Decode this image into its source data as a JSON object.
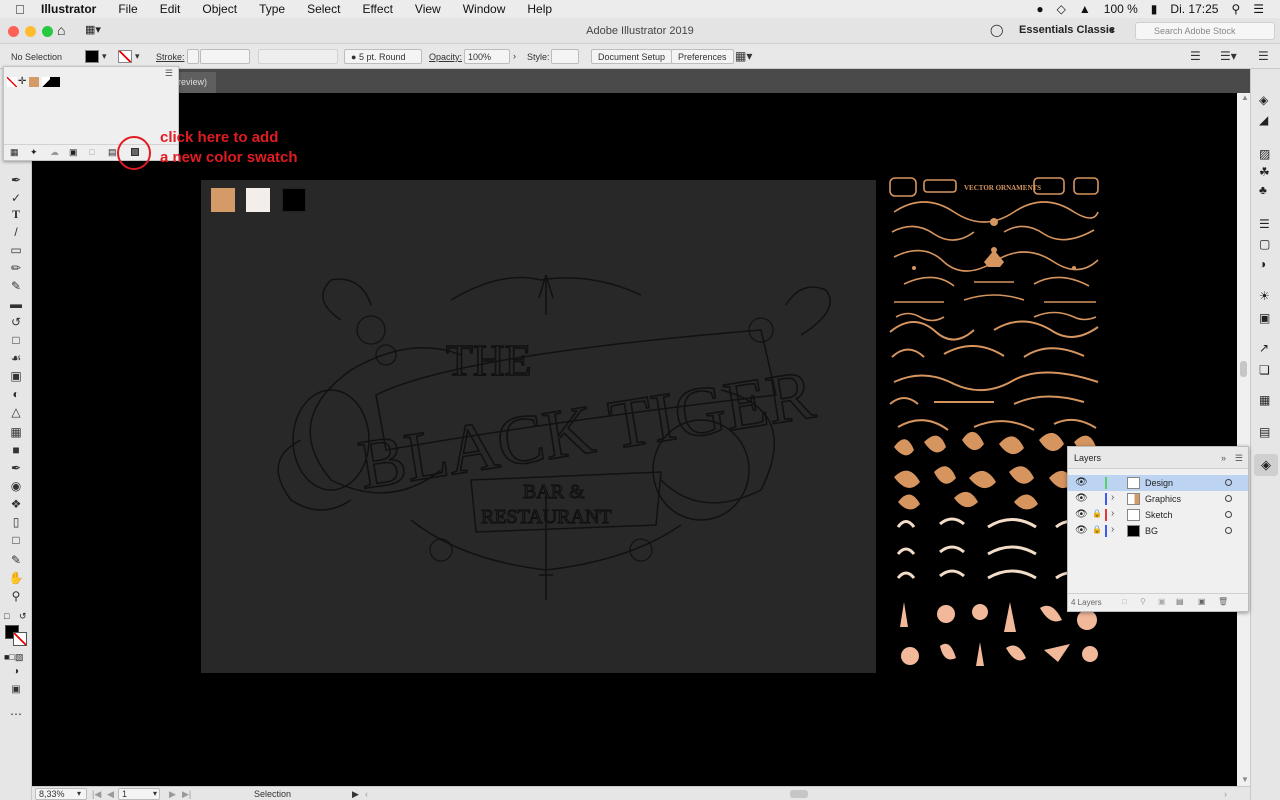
{
  "menubar": {
    "app": "Illustrator",
    "items": [
      "File",
      "Edit",
      "Object",
      "Type",
      "Select",
      "Effect",
      "View",
      "Window",
      "Help"
    ],
    "battery": "100 %",
    "clock": "Di. 17:25"
  },
  "titlebar": {
    "title": "Adobe Illustrator 2019",
    "workspace": "Essentials Classic",
    "search_placeholder": "Search Adobe Stock"
  },
  "control": {
    "selection": "No Selection",
    "stroke_label": "Stroke:",
    "brush": "5 pt. Round",
    "opacity_label": "Opacity:",
    "opacity_value": "100%",
    "style_label": "Style:",
    "doc_setup": "Document Setup",
    "preferences": "Preferences"
  },
  "tab": {
    "partial_label": "review)"
  },
  "annotation": {
    "line1": "click here to add",
    "line2": "a new color swatch"
  },
  "swatches": {
    "colors": [
      "#d49a67",
      "#f3eeea",
      "#000000"
    ]
  },
  "sketch": {
    "line1": "THE",
    "line2": "BLACK TIGER",
    "line3": "BAR &",
    "line4": "RESTAURANT"
  },
  "ornaments": {
    "heading": "VECTOR ORNAMENTS",
    "accent": "#d6955f"
  },
  "layers": {
    "title": "Layers",
    "rows": [
      {
        "name": "Design",
        "color": "#4fd46a",
        "locked": false,
        "selected": true
      },
      {
        "name": "Graphics",
        "color": "#3a5cf0",
        "locked": false,
        "selected": false
      },
      {
        "name": "Sketch",
        "color": "#e03a3a",
        "locked": true,
        "selected": false
      },
      {
        "name": "BG",
        "color": "#3a5cf0",
        "locked": true,
        "selected": false
      }
    ],
    "count": "4 Layers"
  },
  "status": {
    "zoom": "8,33%",
    "artboard": "1",
    "tool": "Selection"
  }
}
